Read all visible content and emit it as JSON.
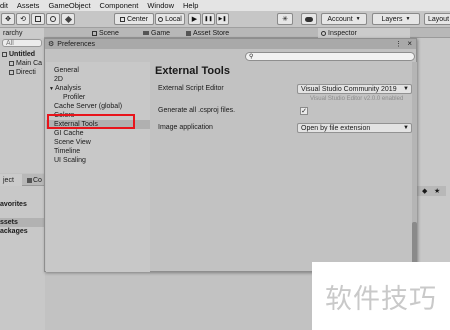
{
  "menu": [
    "dit",
    "Assets",
    "GameObject",
    "Component",
    "Window",
    "Help"
  ],
  "toolbar": {
    "tool_glyphs": [
      "✥",
      "⟲"
    ],
    "center": "Center",
    "local": "Local",
    "play": "▶",
    "pause": "❚❚",
    "step": "▶❚",
    "account": "Account",
    "layers": "Layers",
    "layout": "Layout"
  },
  "tabs": {
    "hierarchy": "rarchy",
    "scene": "Scene",
    "game": "Game",
    "asset_store": "Asset Store",
    "inspector": "Inspector"
  },
  "hierarchy": {
    "search_placeholder": "All",
    "items": [
      "Untitled",
      "Main Ca",
      "Directi"
    ]
  },
  "project": {
    "tab_object": "ject",
    "tab_console": "Co",
    "favorites": "avorites",
    "assets": "ssets",
    "packages": "ackages"
  },
  "preferences": {
    "title": "Preferences",
    "nav": [
      {
        "label": "General"
      },
      {
        "label": "2D"
      },
      {
        "label": "Analysis"
      },
      {
        "label": "Profiler"
      },
      {
        "label": "Cache Server (global)"
      },
      {
        "label": "Colors"
      },
      {
        "label": "External Tools"
      },
      {
        "label": "GI Cache"
      },
      {
        "label": "Scene View"
      },
      {
        "label": "Timeline"
      },
      {
        "label": "UI Scaling"
      }
    ],
    "heading": "External Tools",
    "script_editor_label": "External Script Editor",
    "script_editor_value": "Visual Studio Community 2019",
    "script_editor_version": "Visual Studio Editor v2.0.0 enabled",
    "generate_label": "Generate all .csproj files.",
    "generate_checked": "✓",
    "image_app_label": "Image application",
    "image_app_value": "Open by file extension"
  },
  "watermark": "软件技巧"
}
